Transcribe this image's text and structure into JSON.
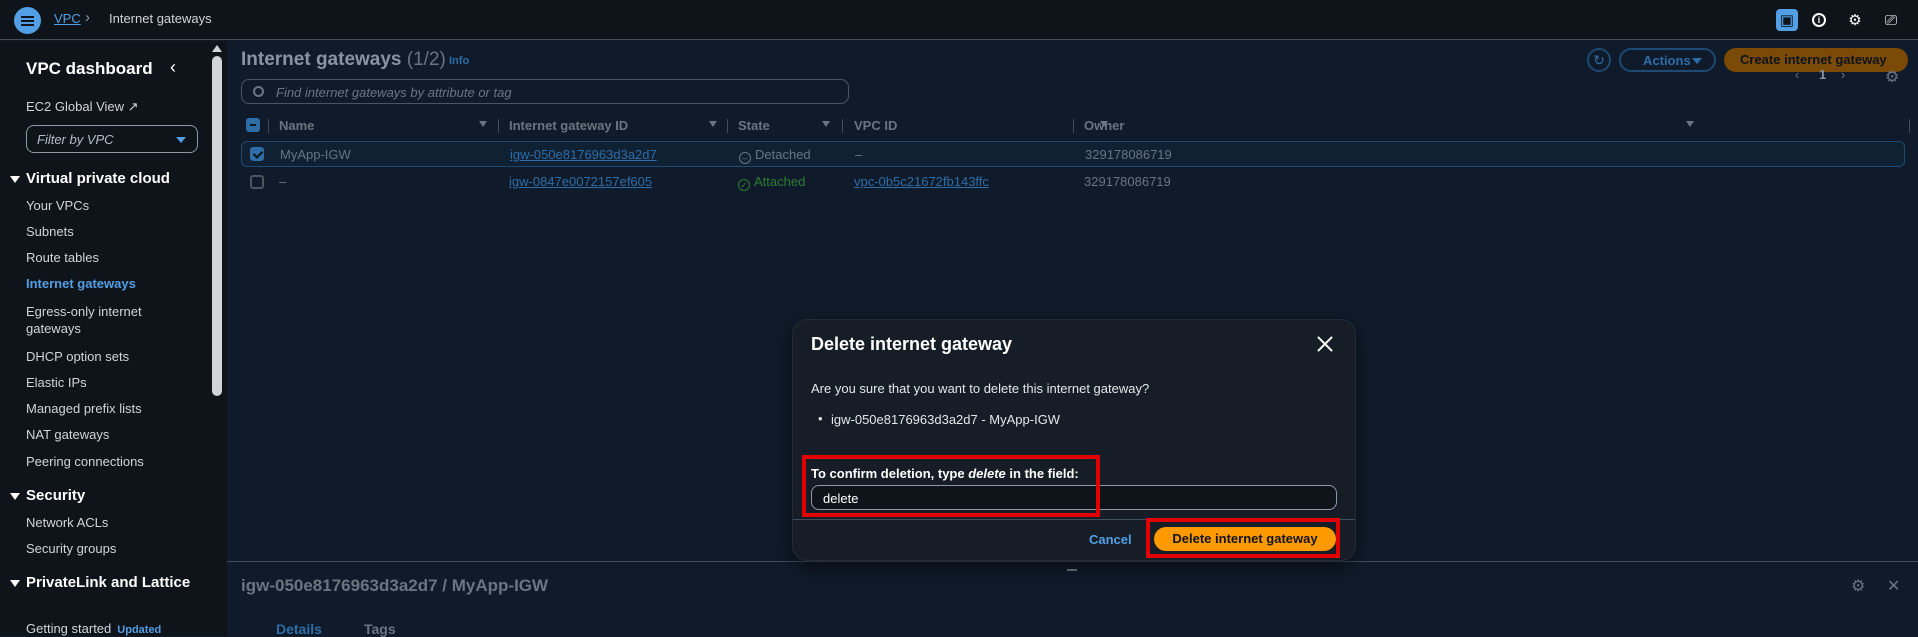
{
  "topbar": {
    "breadcrumb_root": "VPC",
    "breadcrumb_current": "Internet gateways"
  },
  "sidebar": {
    "title": "VPC dashboard",
    "ec2_link": "EC2 Global View",
    "filter_placeholder": "Filter by VPC",
    "section_vpc": "Virtual private cloud",
    "items": [
      "Your VPCs",
      "Subnets",
      "Route tables",
      "Internet gateways",
      "Egress-only internet gateways",
      "DHCP option sets",
      "Elastic IPs",
      "Managed prefix lists",
      "NAT gateways",
      "Peering connections"
    ],
    "active_item": "Internet gateways",
    "section_security": "Security",
    "security_items": [
      "Network ACLs",
      "Security groups"
    ],
    "section_privatelink": "PrivateLink and Lattice",
    "privatelink_items": [
      "Getting started"
    ],
    "updated_badge": "Updated"
  },
  "main": {
    "title": "Internet gateways",
    "count": "(1/2)",
    "info": "Info",
    "search_placeholder": "Find internet gateways by attribute or tag",
    "actions_label": "Actions",
    "create_label": "Create internet gateway",
    "page_number": "1",
    "columns": [
      "Name",
      "Internet gateway ID",
      "State",
      "VPC ID",
      "Owner"
    ],
    "rows": [
      {
        "name": "MyApp-IGW",
        "id": "igw-050e8176963d3a2d7",
        "state": "Detached",
        "vpc": "–",
        "owner": "329178086719",
        "selected": true
      },
      {
        "name": "–",
        "id": "igw-0847e0072157ef605",
        "state": "Attached",
        "vpc": "vpc-0b5c21672fb143ffc",
        "owner": "329178086719",
        "selected": false
      }
    ]
  },
  "details": {
    "title": "igw-050e8176963d3a2d7 / MyApp-IGW",
    "tabs": [
      "Details",
      "Tags"
    ]
  },
  "modal": {
    "title": "Delete internet gateway",
    "question": "Are you sure that you want to delete this internet gateway?",
    "item": "igw-050e8176963d3a2d7 - MyApp-IGW",
    "confirm_prefix": "To confirm deletion, type ",
    "confirm_word": "delete",
    "confirm_suffix": " in the field:",
    "input_value": "delete",
    "cancel_label": "Cancel",
    "delete_label": "Delete internet gateway"
  },
  "colors": {
    "accent": "#539fe5",
    "primary_button": "#ff9900",
    "highlight_box": "#e00000"
  }
}
